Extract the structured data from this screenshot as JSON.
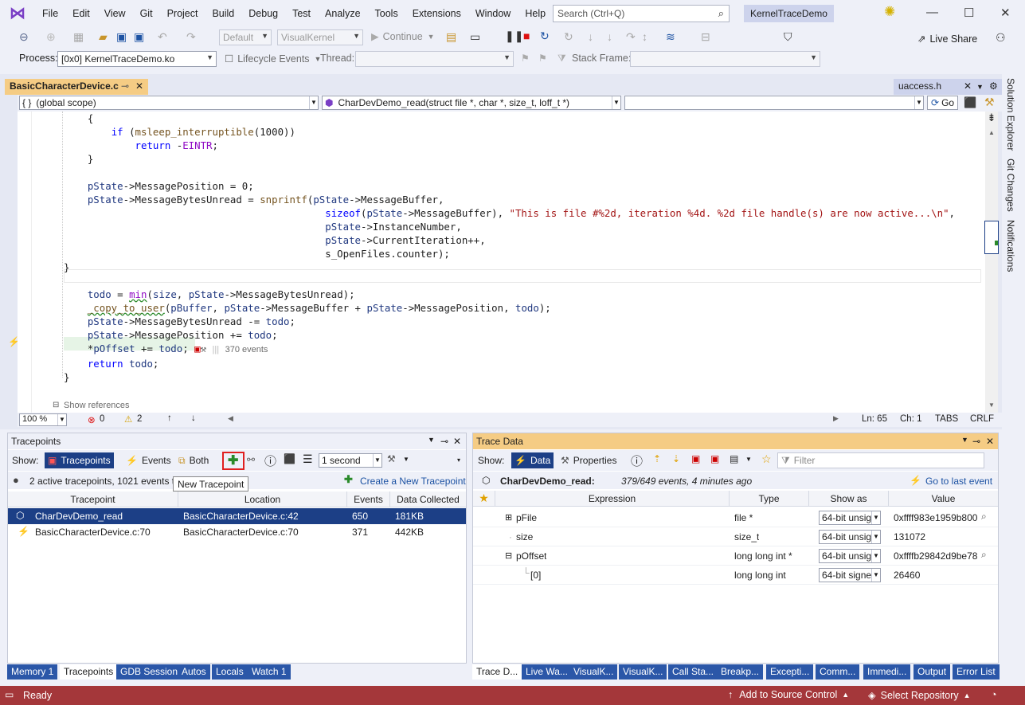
{
  "menu": [
    "File",
    "Edit",
    "View",
    "Git",
    "Project",
    "Build",
    "Debug",
    "Test",
    "Analyze",
    "Tools",
    "Extensions",
    "Window",
    "Help"
  ],
  "search": {
    "placeholder": "Search (Ctrl+Q)"
  },
  "solution_name": "KernelTraceDemo",
  "toolbar": {
    "config": "Default",
    "platform": "VisualKernel",
    "continue_label": "Continue",
    "live_share": "Live Share"
  },
  "debug_toolbar": {
    "process_label": "Process:",
    "process_value": "[0x0] KernelTraceDemo.ko",
    "lifecycle_label": "Lifecycle Events",
    "thread_label": "Thread:",
    "stack_frame_label": "Stack Frame:"
  },
  "editor": {
    "tab_title": "BasicCharacterDevice.c",
    "other_tab": "uaccess.h",
    "scope": "(global scope)",
    "function": "CharDevDemo_read(struct file *, char *, size_t, loff_t *)",
    "go_label": "Go",
    "tracepoint_hint": "370 events",
    "show_references": "Show references",
    "zoom": "100 %",
    "errors": "0",
    "warnings": "2",
    "line": "Ln: 65",
    "col": "Ch: 1",
    "tabs": "TABS",
    "eol": "CRLF"
  },
  "right_tabs": [
    "Solution Explorer",
    "Git Changes",
    "Notifications"
  ],
  "tracepoints_panel": {
    "title": "Tracepoints",
    "show_label": "Show:",
    "filters": [
      "Tracepoints",
      "Events",
      "Both"
    ],
    "interval": "1 second",
    "summary": "2 active tracepoints, 1021 events to",
    "tooltip": "New Tracepoint",
    "create_link": "Create a New Tracepoint",
    "columns": [
      "Tracepoint",
      "Location",
      "Events",
      "Data Collected"
    ],
    "rows": [
      {
        "name": "CharDevDemo_read",
        "location": "BasicCharacterDevice.c:42",
        "events": "650",
        "data": "181KB"
      },
      {
        "name": "BasicCharacterDevice.c:70",
        "location": "BasicCharacterDevice.c:70",
        "events": "371",
        "data": "442KB"
      }
    ]
  },
  "trace_data_panel": {
    "title": "Trace Data",
    "show_label": "Show:",
    "data_label": "Data",
    "properties_label": "Properties",
    "filter_placeholder": "Filter",
    "header_func": "CharDevDemo_read:",
    "header_info": "379/649 events, 4 minutes ago",
    "goto_last": "Go to last event",
    "columns": [
      "Expression",
      "Type",
      "Show as",
      "Value"
    ],
    "rows": [
      {
        "expr": "pFile",
        "type": "file *",
        "show_as": "64-bit unsig",
        "value": "0xffff983e1959b800"
      },
      {
        "expr": "size",
        "type": "size_t",
        "show_as": "64-bit unsig",
        "value": "131072"
      },
      {
        "expr": "pOffset",
        "type": "long long int *",
        "show_as": "64-bit unsig",
        "value": "0xffffb29842d9be78"
      },
      {
        "expr": "[0]",
        "type": "long long int",
        "show_as": "64-bit signe",
        "value": "26460"
      }
    ]
  },
  "bottom_left_tabs": [
    "Memory 1",
    "Tracepoints",
    "GDB Session",
    "Autos",
    "Locals",
    "Watch 1"
  ],
  "bottom_right_tabs": [
    "Trace D...",
    "Live Wa...",
    "VisualK...",
    "VisualK...",
    "Call Sta...",
    "Breakp...",
    "Excepti...",
    "Comm...",
    "Immedi...",
    "Output",
    "Error List"
  ],
  "statusbar": {
    "ready": "Ready",
    "source_control": "Add to Source Control",
    "repository": "Select Repository"
  }
}
